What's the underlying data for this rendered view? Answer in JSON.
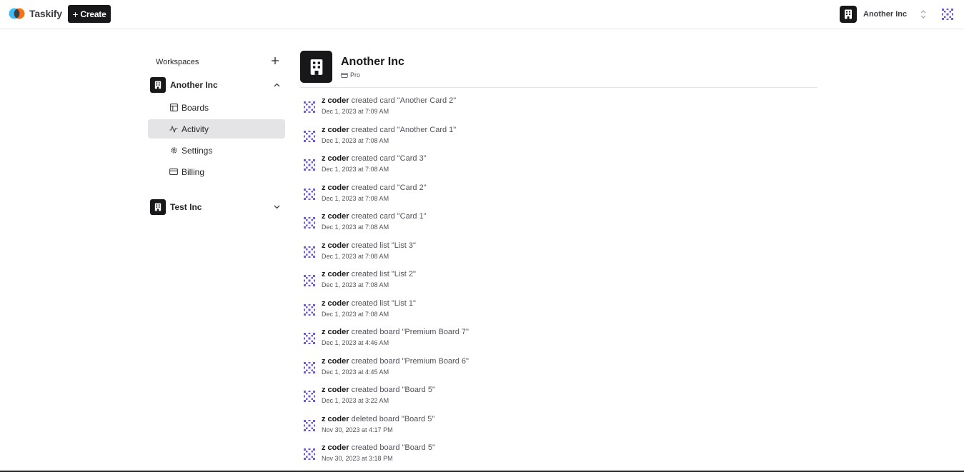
{
  "app": {
    "name": "Taskify",
    "create_label": "Create",
    "current_workspace": "Another Inc"
  },
  "sidebar": {
    "header": "Workspaces",
    "orgs": [
      {
        "name": "Another Inc",
        "expanded": true,
        "items": [
          {
            "label": "Boards",
            "icon": "layout-icon"
          },
          {
            "label": "Activity",
            "icon": "activity-icon",
            "active": true
          },
          {
            "label": "Settings",
            "icon": "gear-icon"
          },
          {
            "label": "Billing",
            "icon": "credit-card-icon"
          }
        ]
      },
      {
        "name": "Test Inc",
        "expanded": false
      }
    ]
  },
  "main": {
    "org_name": "Another Inc",
    "plan": "Pro",
    "activity": [
      {
        "user": "z coder",
        "action": "created card \"Another Card 2\"",
        "time": "Dec 1, 2023 at 7:09 AM"
      },
      {
        "user": "z coder",
        "action": "created card \"Another Card 1\"",
        "time": "Dec 1, 2023 at 7:08 AM"
      },
      {
        "user": "z coder",
        "action": "created card \"Card 3\"",
        "time": "Dec 1, 2023 at 7:08 AM"
      },
      {
        "user": "z coder",
        "action": "created card \"Card 2\"",
        "time": "Dec 1, 2023 at 7:08 AM"
      },
      {
        "user": "z coder",
        "action": "created card \"Card 1\"",
        "time": "Dec 1, 2023 at 7:08 AM"
      },
      {
        "user": "z coder",
        "action": "created list \"List 3\"",
        "time": "Dec 1, 2023 at 7:08 AM"
      },
      {
        "user": "z coder",
        "action": "created list \"List 2\"",
        "time": "Dec 1, 2023 at 7:08 AM"
      },
      {
        "user": "z coder",
        "action": "created list \"List 1\"",
        "time": "Dec 1, 2023 at 7:08 AM"
      },
      {
        "user": "z coder",
        "action": "created board \"Premium Board 7\"",
        "time": "Dec 1, 2023 at 4:46 AM"
      },
      {
        "user": "z coder",
        "action": "created board \"Premium Board 6\"",
        "time": "Dec 1, 2023 at 4:45 AM"
      },
      {
        "user": "z coder",
        "action": "created board \"Board 5\"",
        "time": "Dec 1, 2023 at 3:22 AM"
      },
      {
        "user": "z coder",
        "action": "deleted board \"Board 5\"",
        "time": "Nov 30, 2023 at 4:17 PM"
      },
      {
        "user": "z coder",
        "action": "created board \"Board 5\"",
        "time": "Nov 30, 2023 at 3:18 PM"
      }
    ]
  },
  "colors": {
    "primary_dark": "#18181b",
    "active_bg": "#e4e4e7",
    "logo_blue": "#38bdf8",
    "logo_orange": "#f97316",
    "avatar_purple": "#6d5fd3"
  }
}
